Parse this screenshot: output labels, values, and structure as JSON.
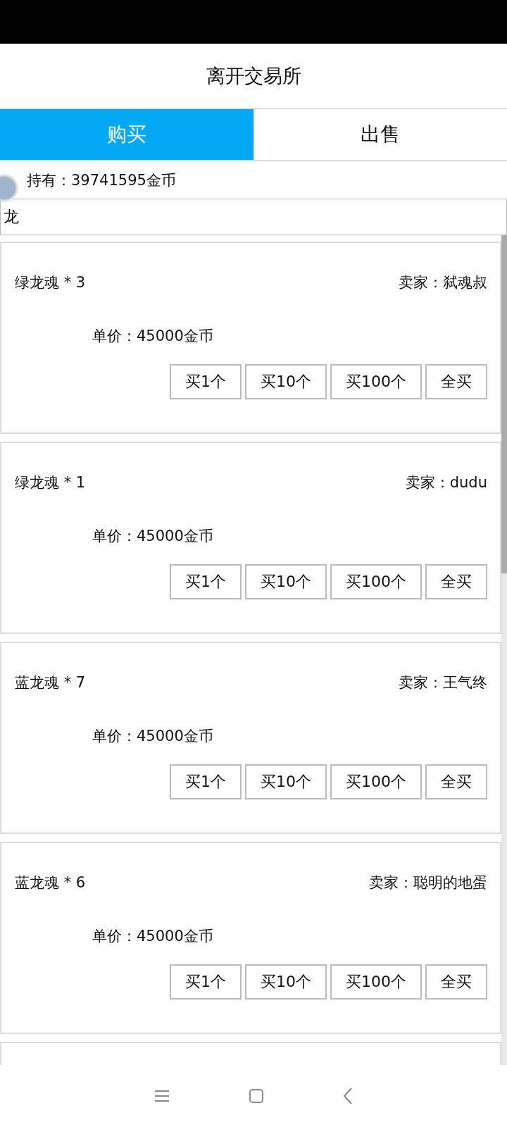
{
  "header": {
    "title": "离开交易所"
  },
  "tabs": [
    {
      "label": "购买",
      "selected": true
    },
    {
      "label": "出售",
      "selected": false
    }
  ],
  "balance": "持有：39741595金币",
  "search": {
    "value": "龙"
  },
  "listings": [
    {
      "item": "绿龙魂 * 3",
      "seller": "卖家：弑魂叔",
      "price": "单价：45000金币",
      "buttons": [
        "买1个",
        "买10个",
        "买100个",
        "全买"
      ]
    },
    {
      "item": "绿龙魂 * 1",
      "seller": "卖家：dudu",
      "price": "单价：45000金币",
      "buttons": [
        "买1个",
        "买10个",
        "买100个",
        "全买"
      ]
    },
    {
      "item": "蓝龙魂 * 7",
      "seller": "卖家：王气终",
      "price": "单价：45000金币",
      "buttons": [
        "买1个",
        "买10个",
        "买100个",
        "全买"
      ]
    },
    {
      "item": "蓝龙魂 * 6",
      "seller": "卖家：聪明的地蛋",
      "price": "单价：45000金币",
      "buttons": [
        "买1个",
        "买10个",
        "买100个",
        "全买"
      ]
    }
  ]
}
